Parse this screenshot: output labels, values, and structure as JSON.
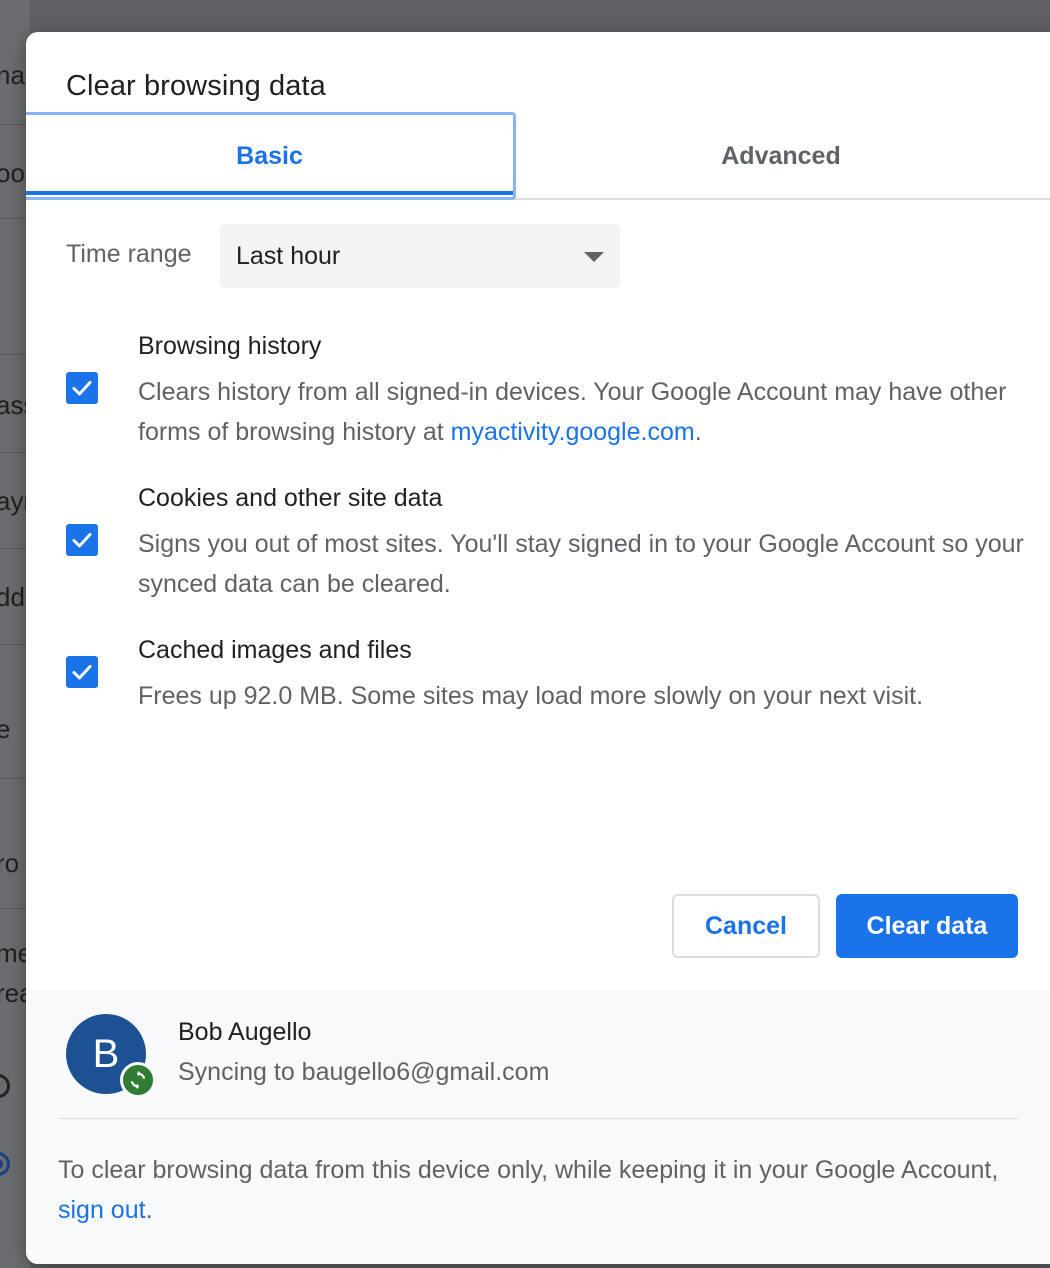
{
  "background": {
    "fragments": [
      "na",
      "oo",
      "ass",
      "ayr",
      "dd",
      "e",
      "ro",
      "me",
      "rea"
    ]
  },
  "dialog": {
    "title": "Clear browsing data",
    "tabs": [
      {
        "label": "Basic",
        "selected": true
      },
      {
        "label": "Advanced",
        "selected": false
      }
    ],
    "time_range": {
      "label": "Time range",
      "value": "Last hour"
    },
    "items": [
      {
        "title": "Browsing history",
        "desc_before": "Clears history from all signed-in devices. Your Google Account may have other forms of browsing history at ",
        "link": "myactivity.google.com",
        "desc_after": ".",
        "checked": true
      },
      {
        "title": "Cookies and other site data",
        "desc": "Signs you out of most sites. You'll stay signed in to your Google Account so your synced data can be cleared.",
        "checked": true
      },
      {
        "title": "Cached images and files",
        "desc": "Frees up 92.0 MB. Some sites may load more slowly on your next visit.",
        "checked": true
      }
    ],
    "buttons": {
      "cancel": "Cancel",
      "clear": "Clear data"
    },
    "account": {
      "initial": "B",
      "name": "Bob Augello",
      "sync_status": "Syncing to baugello6@gmail.com"
    },
    "footer": {
      "note_before": "To clear browsing data from this device only, while keeping it in your Google Account, ",
      "link": "sign out",
      "note_after": "."
    }
  },
  "colors": {
    "accent": "#1a73e8",
    "avatar": "#1c5293",
    "sync_badge": "#2e7d32"
  }
}
